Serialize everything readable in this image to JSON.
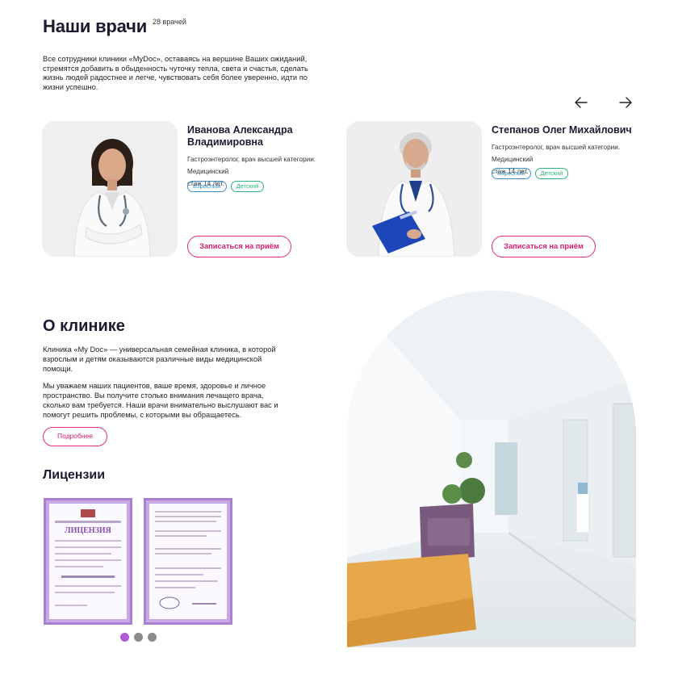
{
  "doctors_section": {
    "title": "Наши врачи",
    "count": "28 врачей",
    "intro": "Все сотрудники клиники «MyDoc», оставаясь на вершине Ваших ожиданий, стремятся добавить в обыденность чуточку тепла, света и счастья, сделать жизнь людей радостнее и легче, чувствовать себя более уверенно, идти по жизни успешно.",
    "prev_icon": "arrow-left-icon",
    "next_icon": "arrow-right-icon",
    "doctors": [
      {
        "name": "Иванова Александра Владимировна",
        "specialty": "Гастроэнтеролог, врач высшей категории.",
        "experience": "Медицинский стаж 14 лет.",
        "tags": [
          "Взрослый",
          "Детский"
        ],
        "button": "Записаться на приём"
      },
      {
        "name": "Степанов Олег Михайлович",
        "specialty": "Гастроэнтеролог, врач высшей категории.",
        "experience": "Медицинский стаж 14 лет.",
        "tags": [
          "Взрослый",
          "Детский"
        ],
        "button": "Записаться на приём"
      }
    ]
  },
  "about_section": {
    "title": "О клинике",
    "paragraph1": "Клиника «My Doc» — универсальная семейная клиника, в которой взрослым и детям оказываются различные виды медицинской помощи.",
    "paragraph2": "Мы уважаем наших пациентов, ваше время, здоровье и личное пространство. Вы получите столько внимания лечащего врача, сколько вам требуется. Наши врачи внимательно выслушают вас и помогут решить проблемы, с которыми вы обращаетесь.",
    "more_button": "Подробнее"
  },
  "licenses_section": {
    "title": "Лицензии",
    "license_heading": "ЛИЦЕНЗИЯ",
    "dots": 3,
    "active_dot": 0
  },
  "colors": {
    "accent": "#e2287a",
    "tag_adult": "#3a8fc9",
    "tag_child": "#2fb37d",
    "dot_active": "#b05ad4",
    "license_frame": "#9b6bc4"
  }
}
